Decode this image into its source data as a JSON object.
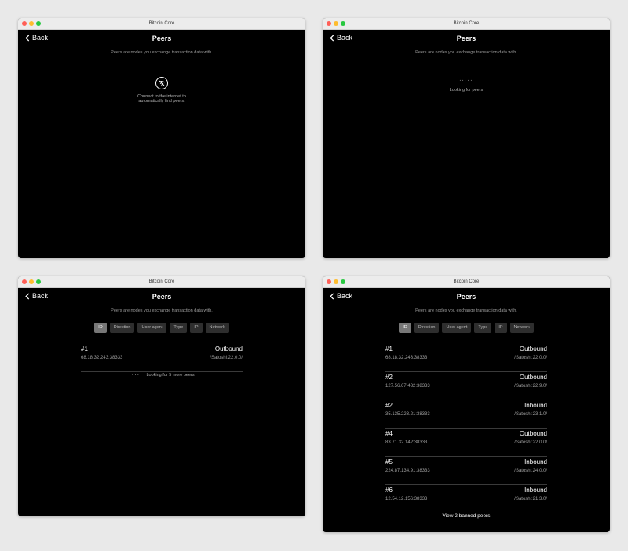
{
  "app_title": "Bitcoin Core",
  "back_label": "Back",
  "page_title": "Peers",
  "subtitle": "Peers are nodes you exchange transaction data with.",
  "colors": {
    "close": "#ff5f57",
    "minimize": "#febc2e",
    "zoom": "#28c840"
  },
  "offline": {
    "icon": "wifi-off-icon",
    "message_line1": "Connect to the internet to",
    "message_line2": "automatically find peers."
  },
  "searching": {
    "dots": "·····",
    "message": "Looking for peers"
  },
  "filters": [
    "ID",
    "Direction",
    "User agent",
    "Type",
    "IP",
    "Network"
  ],
  "partial": {
    "peer": {
      "id": "#1",
      "ip": "68.18.32.243:38333",
      "direction": "Outbound",
      "agent": "/Satoshi:22.0.0/"
    },
    "dots": "·····",
    "looking_more": "Looking for 5 more peers"
  },
  "peers": [
    {
      "id": "#1",
      "ip": "68.18.32.243:38333",
      "direction": "Outbound",
      "agent": "/Satoshi:22.0.0/"
    },
    {
      "id": "#2",
      "ip": "127.56.67.432:38333",
      "direction": "Outbound",
      "agent": "/Satoshi:22.9.0/"
    },
    {
      "id": "#2",
      "ip": "35.135.223.21:38333",
      "direction": "Inbound",
      "agent": "/Satoshi:23.1.0/"
    },
    {
      "id": "#4",
      "ip": "83.71.32.142:38333",
      "direction": "Outbound",
      "agent": "/Satoshi:22.0.0/"
    },
    {
      "id": "#5",
      "ip": "224.87.134.91:38333",
      "direction": "Inbound",
      "agent": "/Satoshi:24.0.0/"
    },
    {
      "id": "#6",
      "ip": "12.54.12.156:38333",
      "direction": "Inbound",
      "agent": "/Satoshi:21.3.0/"
    }
  ],
  "banned_link": "View 2 banned peers"
}
